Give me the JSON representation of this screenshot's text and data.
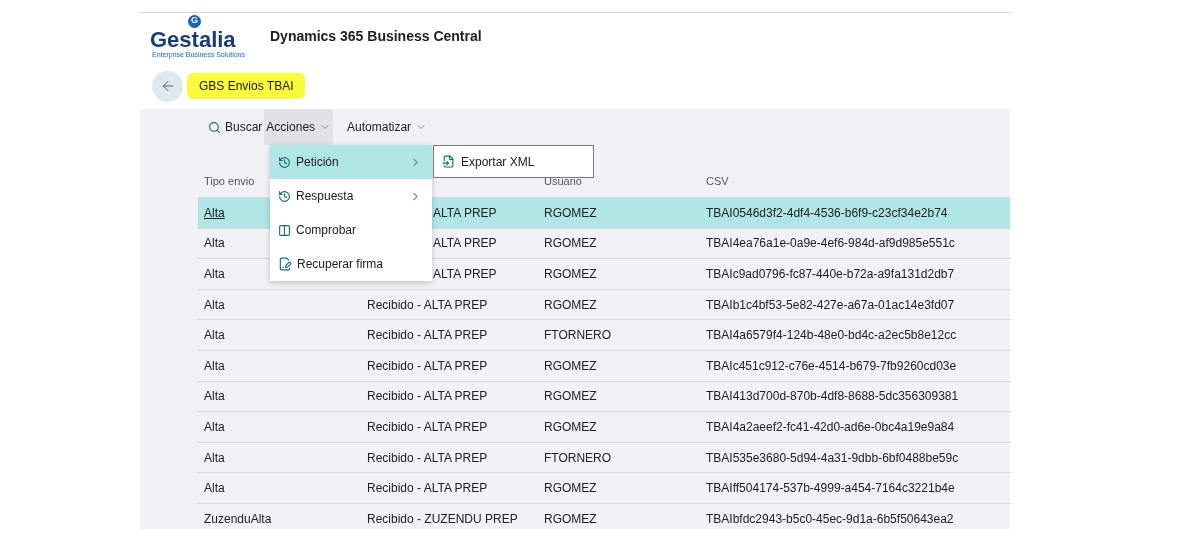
{
  "header": {
    "logo_badge": "G",
    "logo": "Gestalia",
    "logo_tagline": "Enterprise Business Solutions",
    "app_title": "Dynamics 365 Business Central"
  },
  "page": {
    "title": "GBS Envios TBAI"
  },
  "toolbar": [
    {
      "kind": "search",
      "label": "Buscar",
      "expanded": false
    },
    {
      "kind": "menu",
      "label": "Acciones",
      "expanded": true
    },
    {
      "kind": "menu",
      "label": "Automatizar",
      "expanded": false
    }
  ],
  "actions_menu": [
    {
      "label": "Petición",
      "kind": "history",
      "submenu": true,
      "selected": true
    },
    {
      "label": "Respuesta",
      "kind": "history",
      "submenu": true,
      "selected": false
    },
    {
      "label": "Comprobar",
      "kind": "compare",
      "submenu": false,
      "selected": false
    },
    {
      "label": "Recuperar firma",
      "kind": "edit",
      "submenu": false,
      "selected": false
    }
  ],
  "submenu": [
    {
      "label": "Exportar XML"
    }
  ],
  "table": {
    "columns": [
      "Tipo envio",
      "",
      "Usuario",
      "CSV"
    ],
    "rows": [
      {
        "selected": true,
        "cells": [
          "Alta",
          "ALTA PREP",
          "RGOMEZ",
          "TBAI0546d3f2-4df4-4536-b6f9-c23cf34e2b74"
        ]
      },
      {
        "selected": false,
        "cells": [
          "Alta",
          "ALTA PREP",
          "RGOMEZ",
          "TBAI4ea76a1e-0a9e-4ef6-984d-af9d985e551c"
        ]
      },
      {
        "selected": false,
        "cells": [
          "Alta",
          "ALTA PREP",
          "RGOMEZ",
          "TBAIc9ad0796-fc87-440e-b72a-a9fa131d2db7"
        ]
      },
      {
        "selected": false,
        "cells": [
          "Alta",
          "Recibido - ALTA PREP",
          "RGOMEZ",
          "TBAIb1c4bf53-5e82-427e-a67a-01ac14e3fd07"
        ]
      },
      {
        "selected": false,
        "cells": [
          "Alta",
          "Recibido - ALTA PREP",
          "FTORNERO",
          "TBAI4a6579f4-124b-48e0-bd4c-a2ec5b8e12cc"
        ]
      },
      {
        "selected": false,
        "cells": [
          "Alta",
          "Recibido - ALTA PREP",
          "RGOMEZ",
          "TBAIc451c912-c76e-4514-b679-7fb9260cd03e"
        ]
      },
      {
        "selected": false,
        "cells": [
          "Alta",
          "Recibido - ALTA PREP",
          "RGOMEZ",
          "TBAI413d700d-870b-4df8-8688-5dc356309381"
        ]
      },
      {
        "selected": false,
        "cells": [
          "Alta",
          "Recibido - ALTA PREP",
          "RGOMEZ",
          "TBAI4a2aeef2-fc41-42d0-ad6e-0bc4a19e9a84"
        ]
      },
      {
        "selected": false,
        "cells": [
          "Alta",
          "Recibido - ALTA PREP",
          "FTORNERO",
          "TBAI535e3680-5d94-4a31-9dbb-6bf0488be59c"
        ]
      },
      {
        "selected": false,
        "cells": [
          "Alta",
          "Recibido - ALTA PREP",
          "RGOMEZ",
          "TBAIff504174-537b-4999-a454-7164c3221b4e"
        ]
      },
      {
        "selected": false,
        "cells": [
          "ZuzenduAlta",
          "Recibido - ZUZENDU PREP",
          "RGOMEZ",
          "TBAIbfdc2943-b5c0-45ec-9d1a-6b5f50643ea2"
        ]
      }
    ]
  }
}
